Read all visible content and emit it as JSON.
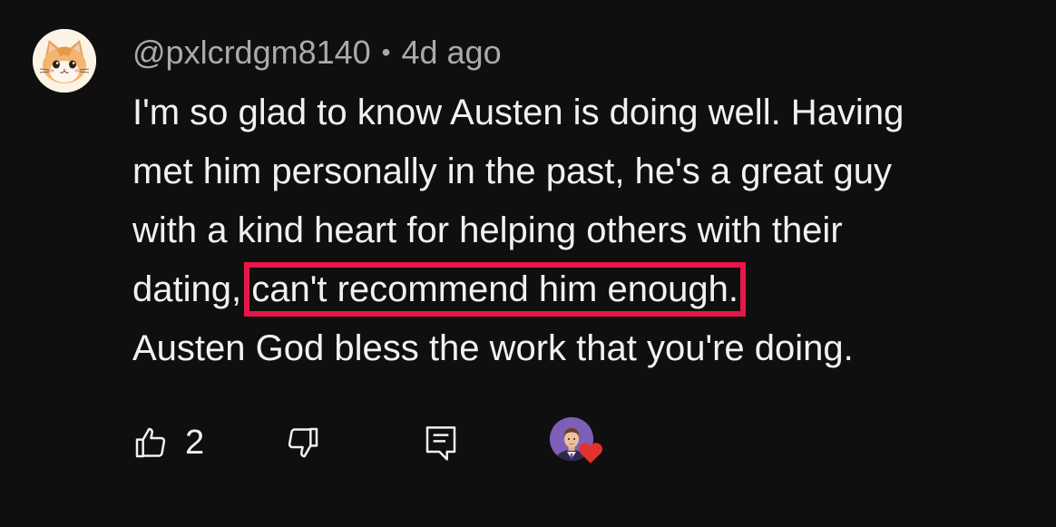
{
  "comment": {
    "author": "@pxlcrdgm8140",
    "separator": "•",
    "timestamp": "4d ago",
    "lines": [
      "I'm so glad to know Austen is doing well. Having",
      "met him personally in the past, he's a great guy",
      "with a kind heart for helping others with their"
    ],
    "line4_before": "dating, ",
    "line4_highlight": "can't recommend him enough.",
    "line5": "Austen God bless the work that you're doing."
  },
  "actions": {
    "like_count": "2",
    "like_icon": "thumbs-up-icon",
    "dislike_icon": "thumbs-down-icon",
    "reply_icon": "reply-comment-icon",
    "creator_heart_icon": "heart-icon"
  },
  "colors": {
    "background": "#0f0f0f",
    "text": "#f1f1f1",
    "meta": "#aaaaaa",
    "highlight_box": "#e8174a",
    "heart": "#e3322c"
  }
}
